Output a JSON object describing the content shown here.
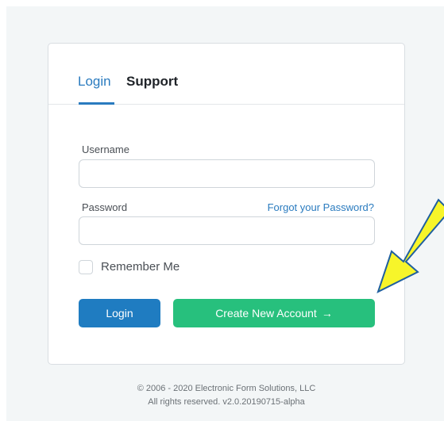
{
  "tabs": {
    "login": "Login",
    "support": "Support"
  },
  "form": {
    "username_label": "Username",
    "username_value": "",
    "password_label": "Password",
    "password_value": "",
    "forgot_link": "Forgot your Password?",
    "remember_label": "Remember Me",
    "remember_checked": false
  },
  "buttons": {
    "login": "Login",
    "create_account": "Create New Account",
    "create_account_arrow": "→"
  },
  "footer": {
    "copyright": "© 2006 - 2020 Electronic Form Solutions, LLC",
    "rights": "All rights reserved. v2.0.20190715-alpha"
  },
  "colors": {
    "accent_blue": "#2a7bbf",
    "login_button": "#1f7cc1",
    "create_button": "#27c07d",
    "annotation_arrow_fill": "#f7f52a"
  },
  "annotation": {
    "icon": "arrow-annotation-icon"
  }
}
